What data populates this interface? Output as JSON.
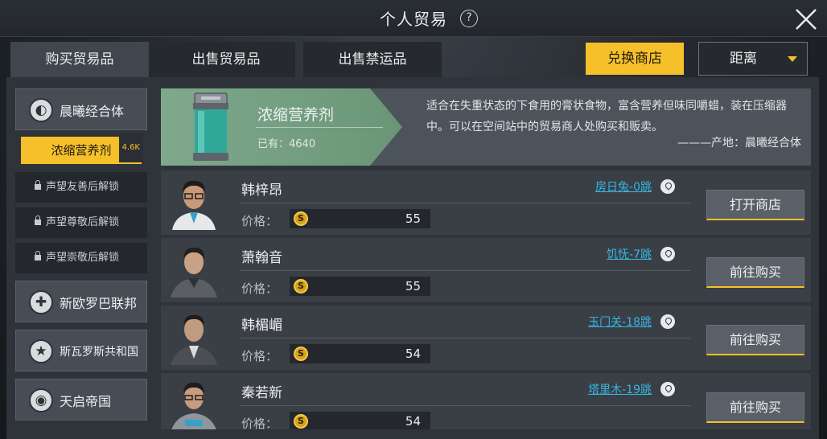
{
  "header": {
    "title": "个人贸易",
    "help_glyph": "?"
  },
  "tabs": [
    {
      "label": "购买贸易品",
      "active": true
    },
    {
      "label": "出售贸易品",
      "active": false
    },
    {
      "label": "出售禁运品",
      "active": false
    }
  ],
  "toolbar": {
    "exchange_label": "兑换商店",
    "sort_value": "距离"
  },
  "sidebar": {
    "factions": [
      {
        "label": "晨曦经合体",
        "icon": "globe-icon",
        "glyph": "◐"
      },
      {
        "label": "新欧罗巴联邦",
        "icon": "cross-icon",
        "glyph": "✚"
      },
      {
        "label": "斯瓦罗斯共和国",
        "icon": "star-icon",
        "glyph": "★"
      },
      {
        "label": "天启帝国",
        "icon": "orb-icon",
        "glyph": "◉"
      }
    ],
    "selected_item": {
      "label": "浓缩营养剂",
      "badge": "4.6K"
    },
    "locked_items": [
      {
        "label": "声望友善后解锁"
      },
      {
        "label": "声望尊敬后解锁"
      },
      {
        "label": "声望崇敬后解锁"
      }
    ]
  },
  "product": {
    "name": "浓缩营养剂",
    "owned": "已有：4640",
    "description": "适合在失重状态的下食用的膏状食物，富含营养但味同嚼蜡，装在压缩器中。可以在空间站中的贸易商人处购买和贩卖。",
    "origin": "———产地：晨曦经合体"
  },
  "merchants": [
    {
      "name": "韩梓昂",
      "price_label": "价格：",
      "price": "55",
      "location": "房日兔-0跳",
      "action": "打开商店"
    },
    {
      "name": "萧翰音",
      "price_label": "价格：",
      "price": "55",
      "location": "饥怃-7跳",
      "action": "前往购买"
    },
    {
      "name": "韩楣嵋",
      "price_label": "价格：",
      "price": "54",
      "location": "玉门关-18跳",
      "action": "前往购买"
    },
    {
      "name": "秦若新",
      "price_label": "价格：",
      "price": "54",
      "location": "塔里木-19跳",
      "action": "前往购买"
    }
  ],
  "coin_glyph": "S",
  "colors": {
    "accent": "#f6c02a",
    "link": "#36b6e6",
    "banner_green": "#7fa88c"
  }
}
